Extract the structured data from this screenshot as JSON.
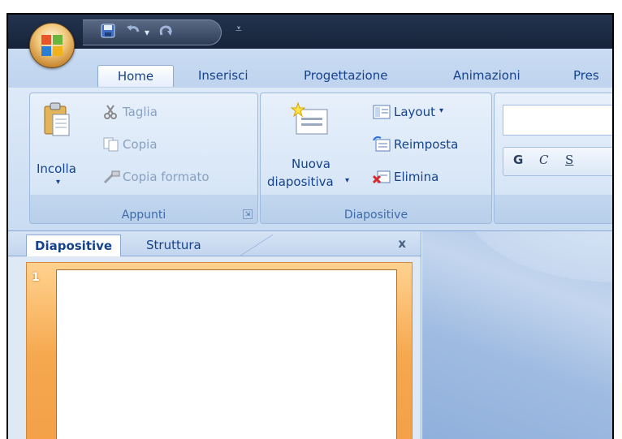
{
  "quick_access": {
    "save_icon": "save-icon",
    "undo_icon": "undo-icon",
    "undo_dropdown": "▾",
    "redo_icon": "redo-icon",
    "customize_symbol": "⩡"
  },
  "tabs": [
    {
      "label": "Home",
      "active": true
    },
    {
      "label": "Inserisci"
    },
    {
      "label": "Progettazione"
    },
    {
      "label": "Animazioni"
    },
    {
      "label": "Pres"
    }
  ],
  "groups": {
    "clipboard": {
      "paste": "Incolla",
      "paste_arrow": "▾",
      "cut": "Taglia",
      "copy": "Copia",
      "format_painter": "Copia formato",
      "label": "Appunti"
    },
    "slides": {
      "new_slide_line1": "Nuova",
      "new_slide_line2": "diapositiva",
      "new_slide_arrow": "▾",
      "layout": "Layout",
      "layout_arrow": "▾",
      "reset": "Reimposta",
      "delete": "Elimina",
      "label": "Diapositive"
    },
    "font": {
      "bold": "G",
      "italic": "C",
      "underline": "S"
    }
  },
  "pane": {
    "tab_slides": "Diapositive",
    "tab_outline": "Struttura",
    "close": "x",
    "slide_number": "1"
  },
  "colors": {
    "titlebar": "#1b2a42",
    "ribbon": "#c9dcf3",
    "thumbnail_frame": "#f5a84e"
  }
}
